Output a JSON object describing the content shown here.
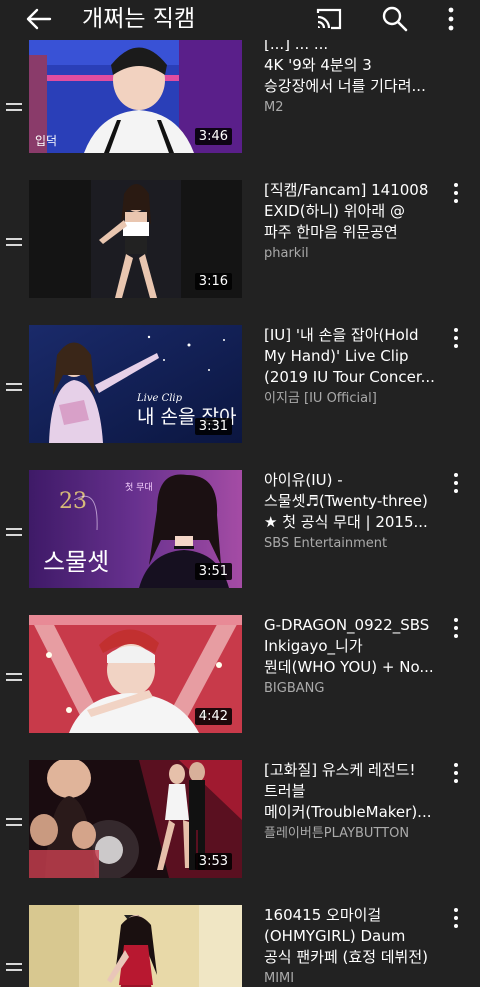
{
  "header": {
    "title": "개쩌는 직캠",
    "back_icon": "arrow-left-icon",
    "cast_icon": "cast-icon",
    "search_icon": "search-icon",
    "more_icon": "more-vert-icon"
  },
  "videos": [
    {
      "title_lines": [
        "[...] ... ...",
        "4K '9와 4분의 3",
        "승강장에서 너를 기다려..."
      ],
      "channel": "M2",
      "duration": "3:46"
    },
    {
      "title_lines": [
        "[직캠/Fancam] 141008",
        "EXID(하니) 위아래 @",
        "파주 한마음 위문공연"
      ],
      "channel": "pharkil",
      "duration": "3:16"
    },
    {
      "title_lines": [
        "[IU] '내 손을 잡아(Hold",
        "My Hand)' Live Clip",
        "(2019 IU Tour Concer..."
      ],
      "channel": "이지금 [IU Official]",
      "duration": "3:31",
      "thumb_caption": "내 손을 잡아",
      "thumb_caption_small": "Live Clip"
    },
    {
      "title_lines": [
        "아이유(IU) -",
        "스물셋♬(Twenty-three)",
        "★ 첫 공식 무대 | 2015..."
      ],
      "channel": "SBS Entertainment",
      "duration": "3:51",
      "thumb_caption": "스물셋",
      "thumb_caption_small": "첫 무대"
    },
    {
      "title_lines": [
        "G-DRAGON_0922_SBS",
        "Inkigayo_니가",
        "뭔데(WHO YOU) + No..."
      ],
      "channel": "BIGBANG",
      "duration": "4:42"
    },
    {
      "title_lines": [
        "[고화질] 유스케 레전드!",
        "트러블",
        "메이커(TroubleMaker)..."
      ],
      "channel": "플레이버튼PLAYBUTTON",
      "duration": "3:53"
    },
    {
      "title_lines": [
        "160415 오마이걸",
        "(OHMYGIRL) Daum",
        "공식 팬카페 (효정 데뷔전)"
      ],
      "channel": "MIMI",
      "duration": ""
    }
  ],
  "colors": {
    "background": "#222222",
    "text_primary": "#ffffff",
    "text_secondary": "#aaaaaa"
  }
}
